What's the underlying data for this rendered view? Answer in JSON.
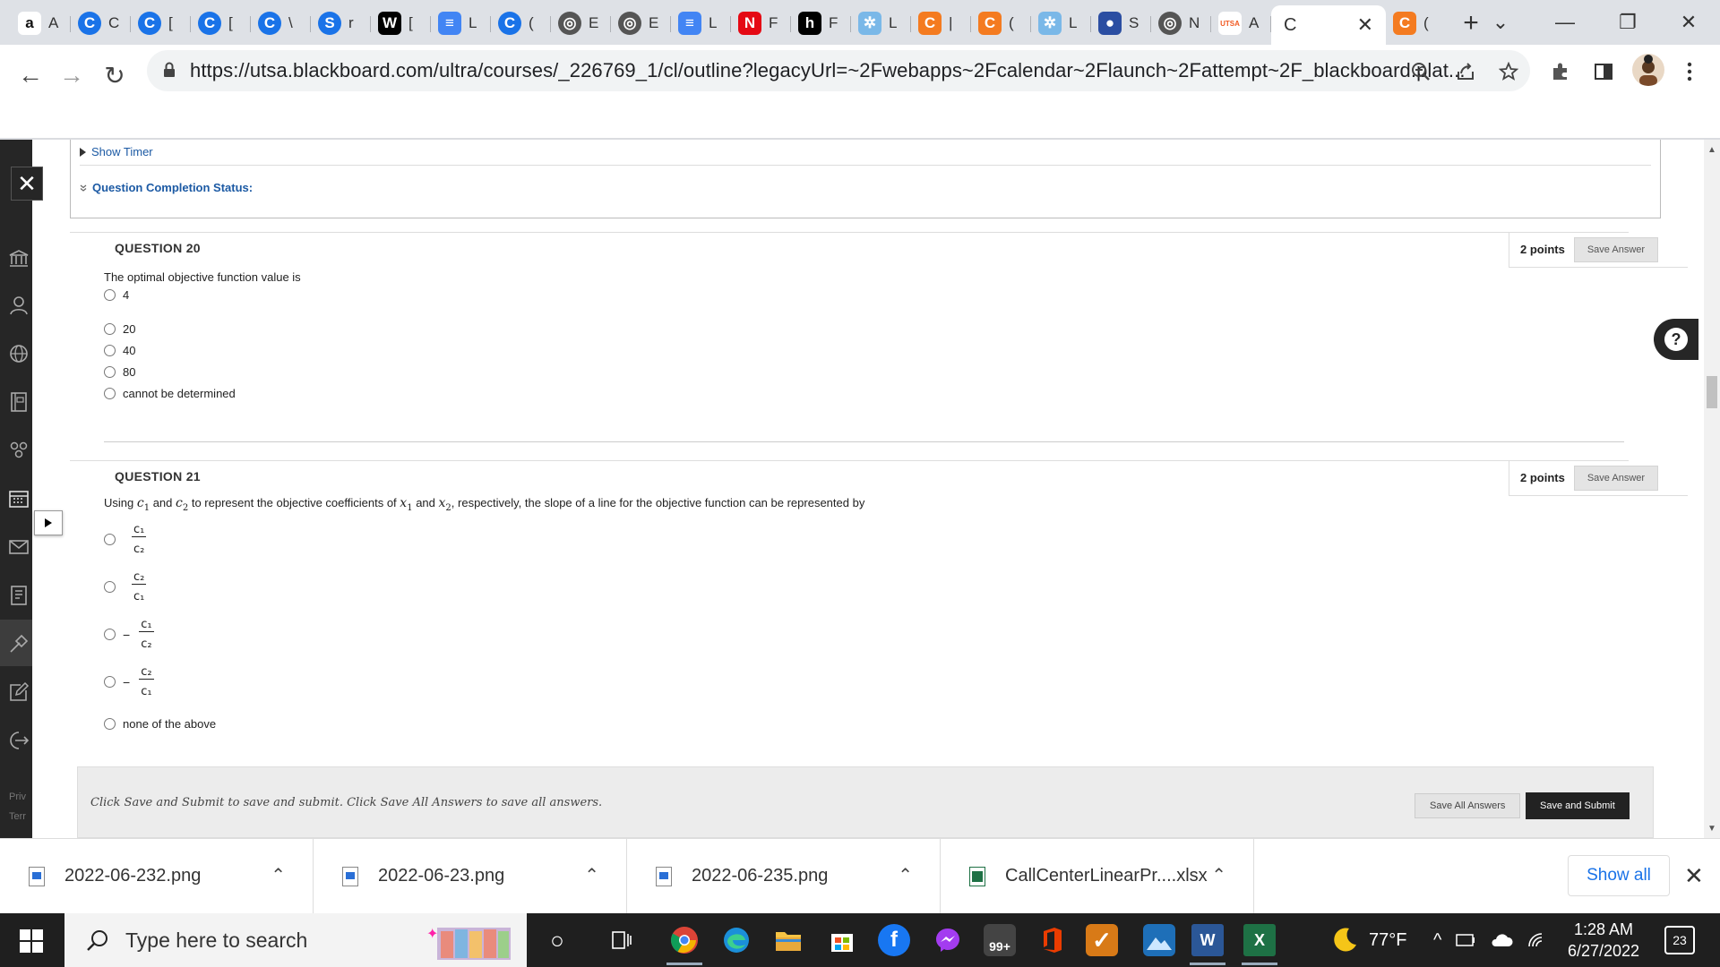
{
  "browser": {
    "tabs": [
      {
        "icon": "amazon-icon",
        "favicon": "a",
        "letter": "A",
        "color": "#fff"
      },
      {
        "icon": "c-icon",
        "favicon": "C",
        "letter": "C",
        "color": "#1a73e8"
      },
      {
        "icon": "c-icon",
        "favicon": "C",
        "letter": "[",
        "color": "#1a73e8"
      },
      {
        "icon": "c-icon",
        "favicon": "C",
        "letter": "[",
        "color": "#1a73e8"
      },
      {
        "icon": "c-icon",
        "favicon": "C",
        "letter": "\\",
        "color": "#1a73e8"
      },
      {
        "icon": "s-icon",
        "favicon": "S",
        "letter": "r",
        "color": "#1a73e8"
      },
      {
        "icon": "w-icon",
        "favicon": "W",
        "letter": "[",
        "color": "#000"
      },
      {
        "icon": "docs-icon",
        "favicon": "≡",
        "letter": "L",
        "color": "#4285f4"
      },
      {
        "icon": "c-icon",
        "favicon": "C",
        "letter": "(",
        "color": "#1a73e8"
      },
      {
        "icon": "globe-icon",
        "favicon": "◎",
        "letter": "E",
        "color": "#555"
      },
      {
        "icon": "globe-icon",
        "favicon": "◎",
        "letter": "E",
        "color": "#555"
      },
      {
        "icon": "docs-icon",
        "favicon": "≡",
        "letter": "L",
        "color": "#4285f4"
      },
      {
        "icon": "netflix-icon",
        "favicon": "N",
        "letter": "F",
        "color": "#e50914"
      },
      {
        "icon": "h-icon",
        "favicon": "h",
        "letter": "F",
        "color": "#000"
      },
      {
        "icon": "puzzle-icon",
        "favicon": "✲",
        "letter": "L",
        "color": "#7ab8e8"
      },
      {
        "icon": "c-icon",
        "favicon": "C",
        "letter": "|",
        "color": "#f47b20"
      },
      {
        "icon": "c-icon",
        "favicon": "C",
        "letter": "(",
        "color": "#f47b20"
      },
      {
        "icon": "puzzle-icon",
        "favicon": "✲",
        "letter": "L",
        "color": "#7ab8e8"
      },
      {
        "icon": "record-icon",
        "favicon": "●",
        "letter": "S",
        "color": "#2b4ea2"
      },
      {
        "icon": "globe-icon",
        "favicon": "◎",
        "letter": "N",
        "color": "#555"
      },
      {
        "icon": "utsa-icon",
        "favicon": "UTSA",
        "letter": "A",
        "color": "#f15a22"
      }
    ],
    "active_tab": {
      "favicon": "C",
      "close": "✕"
    },
    "last_tab": {
      "favicon": "C",
      "letter": "("
    },
    "new_tab": "+",
    "window_controls": {
      "list": "⌄",
      "minimize": "—",
      "restore": "❐",
      "close": "✕"
    },
    "url": "https://utsa.blackboard.com/ultra/courses/_226769_1/cl/outline?legacyUrl=~2Fwebapps~2Fcalendar~2Flaunch~2Fattempt~2F_blackboard.plat...",
    "nav": {
      "back": "←",
      "forward": "→",
      "reload": "↻"
    }
  },
  "bbnav": {
    "close": "✕",
    "footer_privacy": "Priv",
    "footer_terms": "Terr"
  },
  "test": {
    "show_timer": "Show Timer",
    "completion_status": "Question Completion Status:",
    "questions": [
      {
        "title": "QUESTION 20",
        "points": "2 points",
        "save_label": "Save Answer",
        "text": "The optimal objective function value is",
        "options": [
          "4",
          "20",
          "40",
          "80",
          "cannot be determined"
        ]
      },
      {
        "title": "QUESTION 21",
        "points": "2 points",
        "save_label": "Save Answer",
        "text_parts": {
          "a": "Using ",
          "c1": "c",
          "c1sub": "1",
          "and1": " and ",
          "c2": "c",
          "c2sub": "2",
          "mid": " to represent the objective coefficients of ",
          "x1": "x",
          "x1sub": "1",
          "and2": " and ",
          "x2": "x",
          "x2sub": "2",
          "end": ", respectively, the slope of a line for the objective function can be represented by"
        },
        "options": [
          {
            "sign": "",
            "num": "c₁",
            "den": "c₂"
          },
          {
            "sign": "",
            "num": "c₂",
            "den": "c₁"
          },
          {
            "sign": "−",
            "num": "c₁",
            "den": "c₂"
          },
          {
            "sign": "−",
            "num": "c₂",
            "den": "c₁"
          },
          {
            "text": "none of the above"
          }
        ]
      }
    ],
    "submit_message": "Click Save and Submit to save and submit. Click Save All Answers to save all answers.",
    "save_all_label": "Save All Answers",
    "submit_label": "Save and Submit",
    "help": "?"
  },
  "downloads": {
    "items": [
      {
        "name": "2022-06-232.png"
      },
      {
        "name": "2022-06-23.png"
      },
      {
        "name": "2022-06-235.png"
      },
      {
        "name": "CallCenterLinearPr....xlsx"
      }
    ],
    "show_all": "Show all",
    "close": "✕"
  },
  "taskbar": {
    "search_placeholder": "Type here to search",
    "badge": "99+",
    "weather": "77°F",
    "time": "1:28 AM",
    "date": "6/27/2022",
    "notifications": "23"
  }
}
